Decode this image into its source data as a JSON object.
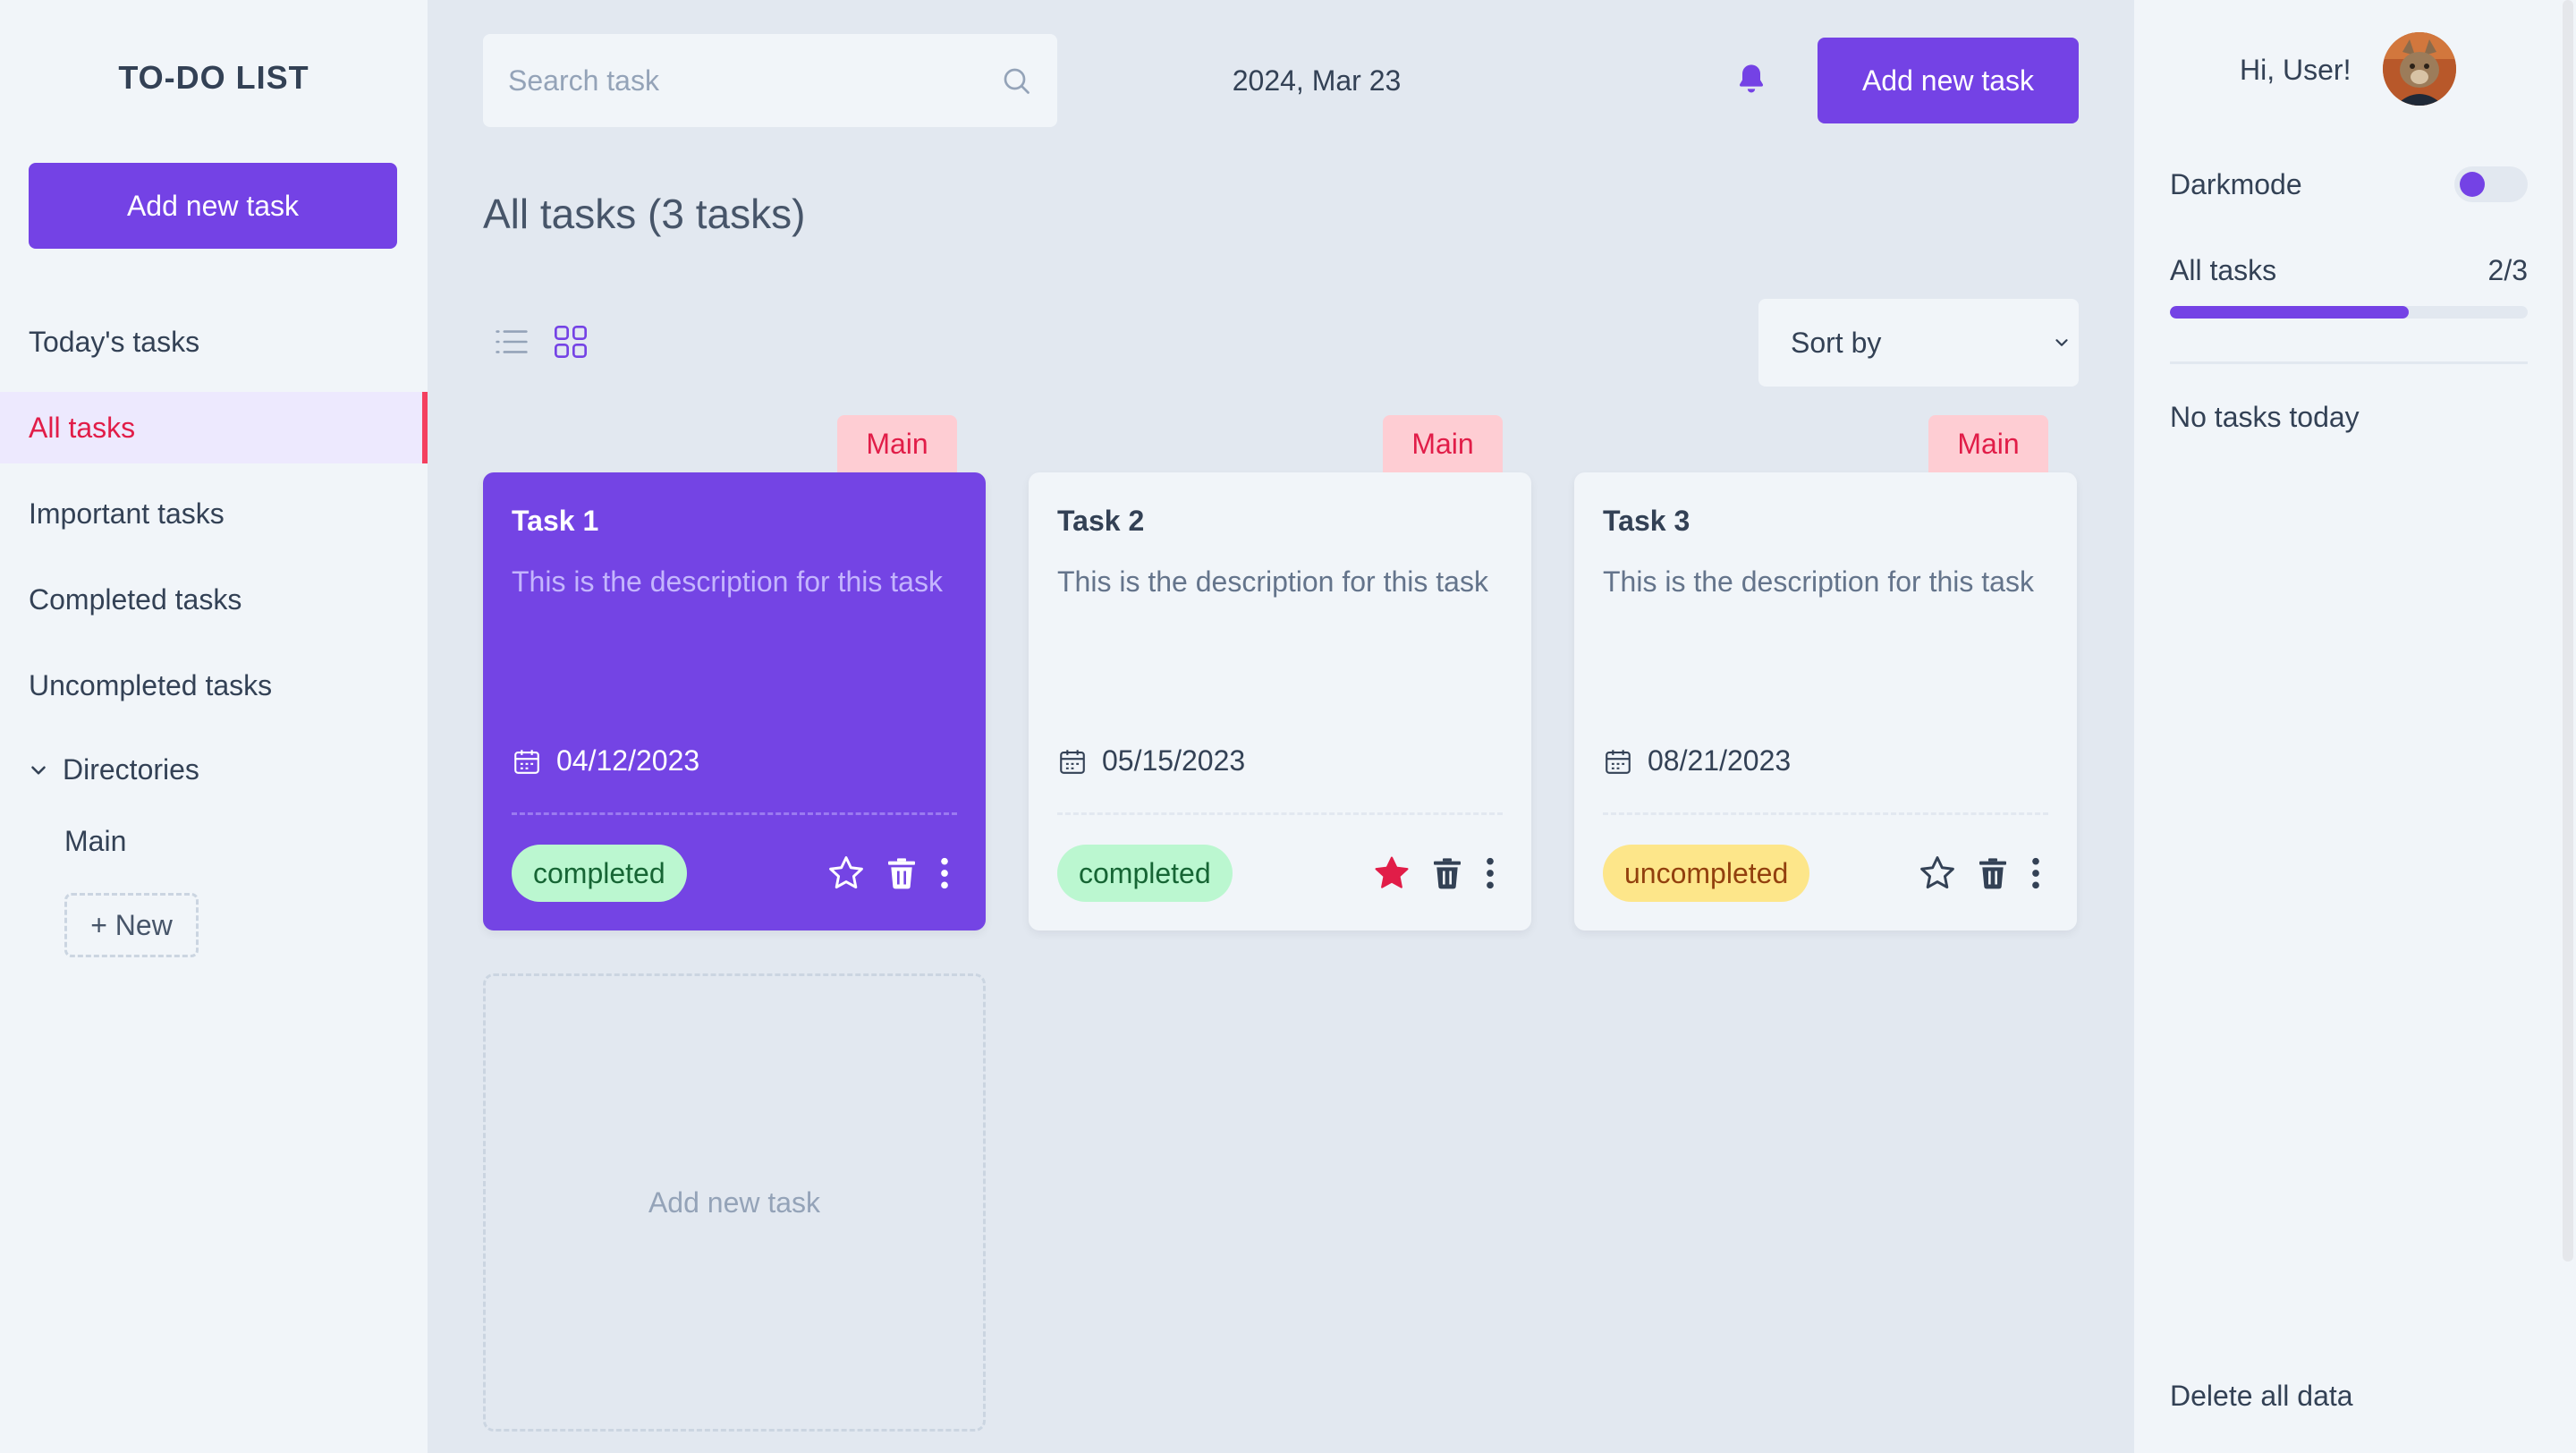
{
  "app": {
    "title": "TO-DO LIST"
  },
  "sidebar": {
    "add_button": "Add new task",
    "items": [
      {
        "label": "Today's tasks",
        "active": false
      },
      {
        "label": "All tasks",
        "active": true
      },
      {
        "label": "Important tasks",
        "active": false
      },
      {
        "label": "Completed tasks",
        "active": false
      },
      {
        "label": "Uncompleted tasks",
        "active": false
      }
    ],
    "directories": {
      "label": "Directories",
      "items": [
        "Main"
      ],
      "new_button": "+ New"
    }
  },
  "header": {
    "search_placeholder": "Search task",
    "date": "2024, Mar 23",
    "add_button": "Add new task"
  },
  "main": {
    "heading": "All tasks (3 tasks)",
    "sort_label": "Sort by",
    "tasks": [
      {
        "directory": "Main",
        "title": "Task 1",
        "description": "This is the description for this task",
        "date": "04/12/2023",
        "status": "completed",
        "important": false
      },
      {
        "directory": "Main",
        "title": "Task 2",
        "description": "This is the description for this task",
        "date": "05/15/2023",
        "status": "completed",
        "important": true
      },
      {
        "directory": "Main",
        "title": "Task 3",
        "description": "This is the description for this task",
        "date": "08/21/2023",
        "status": "uncompleted",
        "important": false
      }
    ],
    "add_card_label": "Add new task"
  },
  "right_panel": {
    "greeting": "Hi, User!",
    "darkmode_label": "Darkmode",
    "darkmode_on": false,
    "progress": {
      "label": "All tasks",
      "count": "2/3",
      "fraction": 0.667
    },
    "today_empty": "No tasks today",
    "delete_all": "Delete all data"
  },
  "colors": {
    "accent": "#7442e5",
    "active_nav_text": "#e11d48",
    "tag_bg": "#fecdd3",
    "completed_bg": "#bbf7d0",
    "uncompleted_bg": "#fde68a",
    "star_active": "#e11d48"
  },
  "icons": {
    "search": "search-icon",
    "bell": "bell-icon",
    "list_view": "list-view-icon",
    "grid_view": "grid-view-icon",
    "chevron": "chevron-down-icon",
    "calendar": "calendar-icon",
    "star": "star-icon",
    "trash": "trash-icon",
    "more": "more-options-icon"
  }
}
